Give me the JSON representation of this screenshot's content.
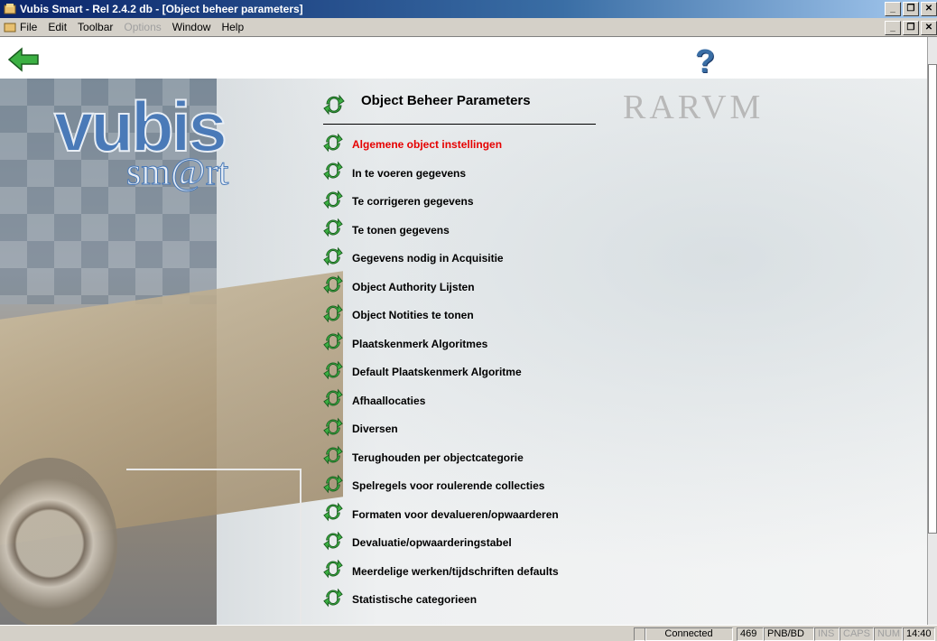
{
  "window": {
    "title": "Vubis Smart - Rel 2.4.2 db - [Object beheer parameters]"
  },
  "menubar": {
    "items": [
      {
        "label": "File",
        "disabled": false
      },
      {
        "label": "Edit",
        "disabled": false
      },
      {
        "label": "Toolbar",
        "disabled": false
      },
      {
        "label": "Options",
        "disabled": true
      },
      {
        "label": "Window",
        "disabled": false
      },
      {
        "label": "Help",
        "disabled": false
      }
    ]
  },
  "toolbar": {
    "back_icon": "back-arrow-icon",
    "help_label": "?"
  },
  "logo": {
    "line1": "vubis",
    "line2": "sm@rt"
  },
  "background": {
    "caption": "RARVM"
  },
  "page": {
    "title": "Object Beheer Parameters"
  },
  "menu": {
    "items": [
      {
        "label": "Algemene object instellingen",
        "active": true
      },
      {
        "label": "In te voeren gegevens"
      },
      {
        "label": "Te corrigeren gegevens"
      },
      {
        "label": "Te tonen gegevens"
      },
      {
        "label": "Gegevens nodig in Acquisitie"
      },
      {
        "label": "Object Authority Lijsten"
      },
      {
        "label": "Object Notities te tonen"
      },
      {
        "label": "Plaatskenmerk Algoritmes"
      },
      {
        "label": "Default Plaatskenmerk Algoritme"
      },
      {
        "label": "Afhaallocaties"
      },
      {
        "label": "Diversen"
      },
      {
        "label": "Terughouden per objectcategorie"
      },
      {
        "label": "Spelregels voor roulerende collecties"
      },
      {
        "label": "Formaten voor devalueren/opwaarderen"
      },
      {
        "label": "Devaluatie/opwaarderingstabel"
      },
      {
        "label": "Meerdelige werken/tijdschriften defaults"
      },
      {
        "label": "Statistische categorieen"
      }
    ]
  },
  "statusbar": {
    "connection": "Connected",
    "count": "469",
    "location": "PNB/BD",
    "ins": "INS",
    "caps": "CAPS",
    "num": "NUM",
    "time": "14:40"
  },
  "colors": {
    "active_item": "#e60000",
    "title_bar": "#0a246a",
    "icon_green": "#2e8b2e"
  }
}
